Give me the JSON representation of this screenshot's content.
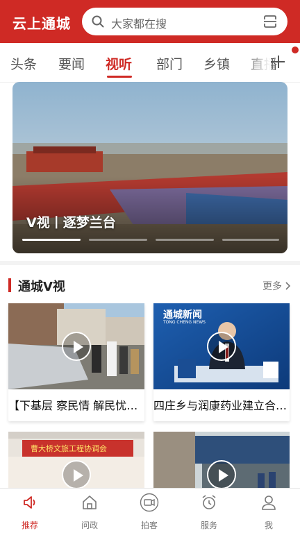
{
  "header": {
    "app_title": "云上通城",
    "search_placeholder": "大家都在搜",
    "brand_color": "#cf2a25"
  },
  "tabs": {
    "items": [
      {
        "label": "头条"
      },
      {
        "label": "要闻"
      },
      {
        "label": "视听",
        "active": true
      },
      {
        "label": "部门"
      },
      {
        "label": "乡镇"
      },
      {
        "label": "直播"
      }
    ],
    "add_icon": "plus-icon"
  },
  "hero": {
    "caption": "V视丨逐梦兰台",
    "slide_count": 4,
    "active_slide": 1
  },
  "section": {
    "title": "通城V视",
    "more_label": "更多"
  },
  "videos": [
    {
      "title": "【下基层 察民情 解民忧】…"
    },
    {
      "title": "四庄乡与润康药业建立合作…"
    },
    {
      "title": ""
    },
    {
      "title": ""
    }
  ],
  "thumb_text": {
    "news_logo": "通城新闻",
    "news_logo_en": "TONG CHENG NEWS",
    "banner_text": "曹大桥文旅工程协调会"
  },
  "bottom_nav": [
    {
      "label": "推荐",
      "icon": "speaker-icon",
      "active": true
    },
    {
      "label": "问政",
      "icon": "home-icon"
    },
    {
      "label": "拍客",
      "icon": "video-camera-icon"
    },
    {
      "label": "服务",
      "icon": "alarm-clock-icon"
    },
    {
      "label": "我",
      "icon": "user-icon"
    }
  ]
}
